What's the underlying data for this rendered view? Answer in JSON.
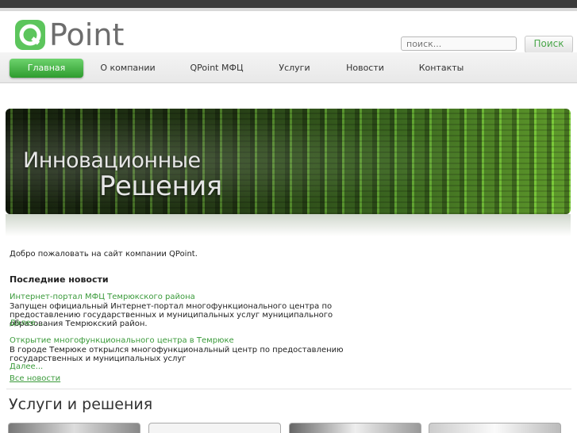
{
  "brand": {
    "logo_text": "Point",
    "accent": "#4aa64a"
  },
  "search": {
    "placeholder": "поиск...",
    "value": "поиск...",
    "button_label": "Поиск"
  },
  "nav": {
    "items": [
      {
        "label": "Главная",
        "active": true
      },
      {
        "label": "О компании",
        "active": false
      },
      {
        "label": "QPoint МФЦ",
        "active": false
      },
      {
        "label": "Услуги",
        "active": false
      },
      {
        "label": "Новости",
        "active": false
      },
      {
        "label": "Контакты",
        "active": false
      }
    ]
  },
  "banner": {
    "line1": "Инновационные",
    "line2": "Решения"
  },
  "main": {
    "welcome": "Добро пожаловать на сайт компании QPoint.",
    "news_heading": "Последние новости",
    "news": [
      {
        "title": "Интернет-портал МФЦ Темрюкского района",
        "body": "Запущен официальный Интернет-портал многофункционального центра по предоставлению государственных и муниципальных услуг муниципального образования Темрюкский район.",
        "more": "Далее..."
      },
      {
        "title": "Открытие многофункционального центра в Темрюке",
        "body": "В городе Темрюке открылся многофункциональный центр по предоставлению государственных и муниципальных услуг",
        "more": "Далее..."
      }
    ],
    "all_news": "Все новости",
    "services_heading": "Услуги и решения"
  }
}
